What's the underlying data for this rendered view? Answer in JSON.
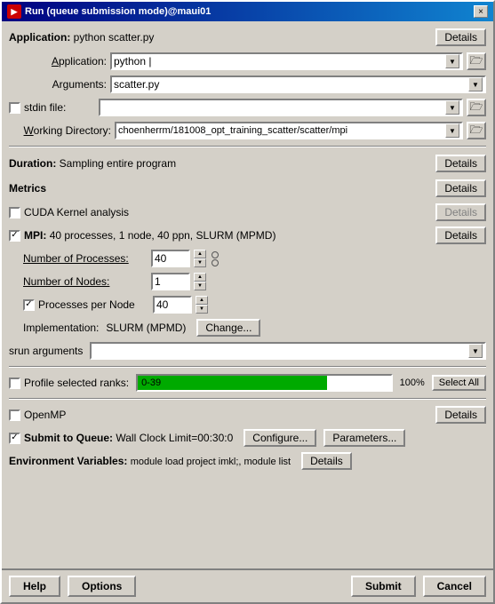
{
  "window": {
    "title": "Run (queue submission mode)@maui01",
    "close_btn": "×"
  },
  "app_section": {
    "label": "Application:",
    "value": "python scatter.py",
    "details_btn": "Details"
  },
  "application_field": {
    "label": "Application:",
    "value": "python |",
    "folder_icon": "📁"
  },
  "arguments_field": {
    "label": "Arguments:",
    "value": "scatter.py"
  },
  "stdin_field": {
    "label": "stdin file:",
    "value": ""
  },
  "working_dir_field": {
    "label": "Working Directory:",
    "value": "choenherrm/181008_opt_training_scatter/scatter/mpi"
  },
  "duration_section": {
    "label": "Duration:",
    "value": "Sampling entire program",
    "details_btn": "Details"
  },
  "metrics_section": {
    "label": "Metrics",
    "details_btn": "Details"
  },
  "cuda_section": {
    "label": "CUDA Kernel analysis",
    "details_btn": "Details",
    "details_disabled": true,
    "checkbox_checked": false
  },
  "mpi_section": {
    "label": "MPI:",
    "value": "40 processes, 1 node, 40 ppn, SLURM (MPMD)",
    "details_btn": "Details",
    "checkbox_checked": true
  },
  "num_processes": {
    "label": "Number of Processes:",
    "value": "40"
  },
  "num_nodes": {
    "label": "Number of Nodes:",
    "value": "1"
  },
  "processes_per_node": {
    "label": "Processes per Node",
    "value": "40",
    "checkbox_checked": true
  },
  "implementation": {
    "label": "Implementation:",
    "value": "SLURM (MPMD)",
    "change_btn": "Change..."
  },
  "srun_args": {
    "label": "srun arguments",
    "value": ""
  },
  "profile_ranks": {
    "label": "Profile selected ranks:",
    "progress_text": "0-39",
    "progress_percent": "100%",
    "progress_fill": 75,
    "select_all_btn": "Select All",
    "checkbox_checked": false
  },
  "openmp_section": {
    "label": "OpenMP",
    "details_btn": "Details",
    "checkbox_checked": false
  },
  "submit_queue": {
    "label": "Submit to Queue:",
    "value": "Wall Clock Limit=00:30:0",
    "configure_btn": "Configure...",
    "parameters_btn": "Parameters...",
    "checkbox_checked": true
  },
  "env_variables": {
    "label": "Environment Variables:",
    "value": "module load project imkl;, module list",
    "details_btn": "Details"
  },
  "bottom": {
    "help_btn": "Help",
    "options_btn": "Options",
    "submit_btn": "Submit",
    "cancel_btn": "Cancel"
  }
}
